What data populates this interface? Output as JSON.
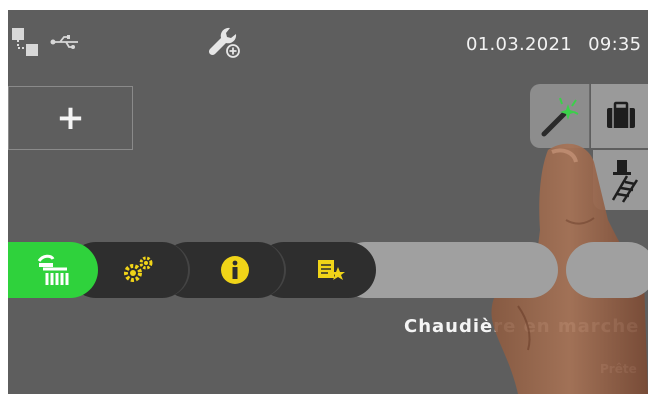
{
  "status_bar": {
    "date": "01.03.2021",
    "time": "09:35",
    "icons": [
      "network-icon",
      "usb-icon",
      "service-tool-icon"
    ]
  },
  "toolbar": {
    "add_label": "+",
    "buttons": [
      "wizard-wand-icon",
      "suitcase-icon",
      "chimney-sweep-icon"
    ]
  },
  "tabs": [
    {
      "icon": "heating-icon",
      "active": true
    },
    {
      "icon": "gears-icon",
      "active": false
    },
    {
      "icon": "info-icon",
      "active": false
    },
    {
      "icon": "notes-star-icon",
      "active": false
    }
  ],
  "status": {
    "main": "Chaudière en marche",
    "sub": "Prête"
  },
  "colors": {
    "screen_bg": "#5e5e5e",
    "active_tab": "#2fd23c",
    "tab_dark": "#2e2e2e",
    "icon_yellow": "#f0d418"
  }
}
